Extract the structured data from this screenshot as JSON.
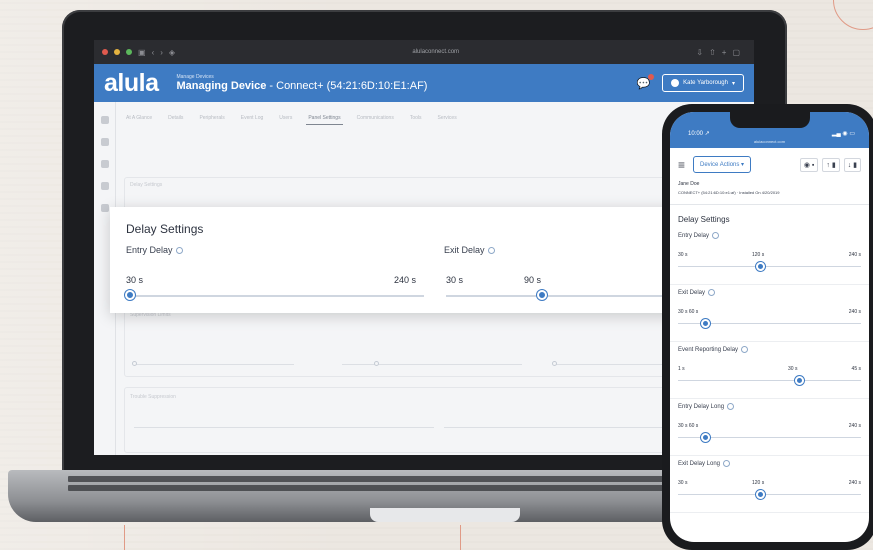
{
  "browser": {
    "url": "alulaconnect.com"
  },
  "header": {
    "logo": "alula",
    "small_title": "Manage Devices",
    "title_bold": "Managing Device",
    "title_rest": " - Connect+ (54:21:6D:10:E1:AF)",
    "user_label": "Kate Yarborough"
  },
  "tabs": [
    {
      "label": "At A Glance",
      "active": false
    },
    {
      "label": "Details",
      "active": false
    },
    {
      "label": "Peripherals",
      "active": false
    },
    {
      "label": "Event Log",
      "active": false
    },
    {
      "label": "Users",
      "active": false
    },
    {
      "label": "Panel Settings",
      "active": true
    },
    {
      "label": "Communications",
      "active": false
    },
    {
      "label": "Tools",
      "active": false
    },
    {
      "label": "Services",
      "active": false
    }
  ],
  "background_sections": {
    "delay": "Delay Settings",
    "supervision": "Supervision Limits",
    "trouble": "Trouble Suppression"
  },
  "delay_settings": {
    "title": "Delay Settings",
    "entry_delay": {
      "label": "Entry Delay",
      "min_label": "30 s",
      "max_label": "240 s",
      "value_fraction": 0.0
    },
    "exit_delay": {
      "label": "Exit Delay",
      "min_label": "30 s",
      "value_label": "90 s",
      "value_fraction": 0.4
    }
  },
  "phone": {
    "time": "10:00 ↗",
    "system_icons": "▂▄ ◉ ▭",
    "url": "alulaconnect.com",
    "device_actions": "Device Actions ▾",
    "icons": [
      "◉ ▪",
      "↑ ▮",
      "↓ ▮"
    ],
    "user_name": "Jane Doe",
    "meta": "CONNECT+ (54:21:6D:10:e1:af) · Installed On 4/20/2019",
    "section_title": "Delay Settings",
    "sliders": [
      {
        "label": "Entry Delay",
        "left": "30 s",
        "mid": "120 s",
        "right": "240 s",
        "value_fraction": 0.45
      },
      {
        "label": "Exit Delay",
        "left": "30 s 60 s",
        "mid": "",
        "right": "240 s",
        "value_fraction": 0.15
      },
      {
        "label": "Event Reporting Delay",
        "left": "1 s",
        "mid": "30 s",
        "right": "45 s",
        "value_fraction": 0.66
      },
      {
        "label": "Entry Delay Long",
        "left": "30 s 60 s",
        "mid": "",
        "right": "240 s",
        "value_fraction": 0.15
      },
      {
        "label": "Exit Delay Long",
        "left": "30 s",
        "mid": "120 s",
        "right": "240 s",
        "value_fraction": 0.45
      }
    ]
  },
  "colors": {
    "brand_blue": "#3e7bc3",
    "accent_red": "#e05a4e"
  }
}
